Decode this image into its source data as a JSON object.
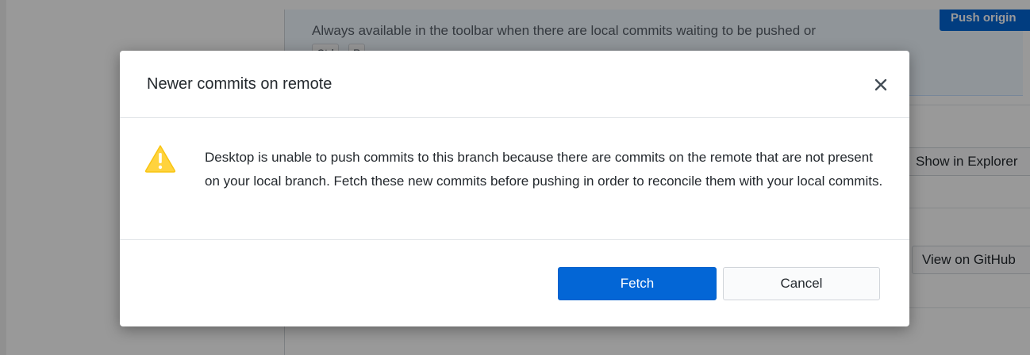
{
  "background": {
    "suggestion": {
      "description": "Always available in the toolbar when there are local commits waiting to be pushed or",
      "shortcut_key_1": "Ctrl",
      "shortcut_key_2": "P",
      "push_button_label": "Push origin"
    },
    "rows": [
      {
        "button_label": "Show in Explorer"
      },
      {
        "button_label": "View on GitHub"
      }
    ]
  },
  "dialog": {
    "title": "Newer commits on remote",
    "close_label": "×",
    "icon": "warning-icon",
    "message": "Desktop is unable to push commits to this branch because there are commits on the remote that are not present on your local branch. Fetch these new commits before pushing in order to reconcile them with your local commits.",
    "primary_button": "Fetch",
    "secondary_button": "Cancel"
  },
  "colors": {
    "accent": "#0366d6",
    "warning": "#ffd33d",
    "overlay": "rgba(0,0,0,0.40)"
  }
}
